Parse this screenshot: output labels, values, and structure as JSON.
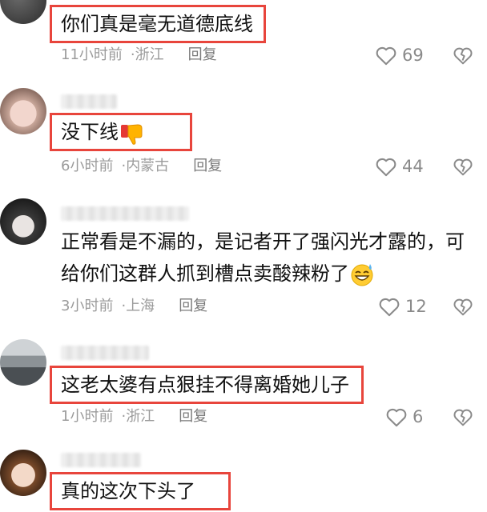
{
  "comments": [
    {
      "text": "你们真是毫无道德底线",
      "time": "11小时前",
      "location": "浙江",
      "reply_label": "回复",
      "likes": "69"
    },
    {
      "text": "没下线",
      "emoji": "thumbs-down-icon",
      "time": "6小时前",
      "location": "内蒙古",
      "reply_label": "回复",
      "likes": "44"
    },
    {
      "line1": "正常看是不漏的，是记者开了强闪光才露的，可",
      "line2": "给你们这群人抓到槽点卖酸辣粉了",
      "emoji": "grinning-sweat-icon",
      "time": "3小时前",
      "location": "上海",
      "reply_label": "回复",
      "likes": "12"
    },
    {
      "text": "这老太婆有点狠挂不得离婚她儿子",
      "time": "1小时前",
      "location": "浙江",
      "reply_label": "回复",
      "likes": "6"
    },
    {
      "text": "真的这次下头了"
    }
  ],
  "colors": {
    "highlight_border": "#e8453c",
    "meta_text": "#9b9b9b",
    "icon": "#8a8a8a"
  }
}
